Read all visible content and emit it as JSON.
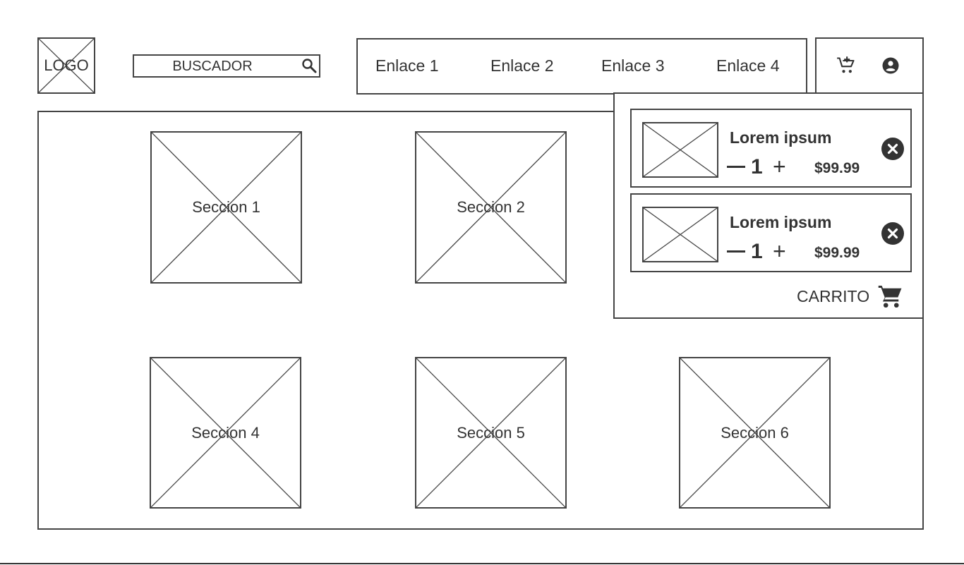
{
  "header": {
    "logo_text": "LOGO",
    "search": {
      "value": "BUSCADOR"
    },
    "nav_links": [
      "Enlace 1",
      "Enlace 2",
      "Enlace 3",
      "Enlace 4"
    ]
  },
  "sections": [
    "Seccion 1",
    "Seccion 2",
    "Seccion 4",
    "Seccion 5",
    "Seccion 6"
  ],
  "cart": {
    "items": [
      {
        "name": "Lorem ipsum",
        "quantity": "1",
        "price": "$99.99"
      },
      {
        "name": "Lorem ipsum",
        "quantity": "1",
        "price": "$99.99"
      }
    ],
    "label": "CARRITO"
  },
  "icons": [
    "add-to-cart-icon",
    "user-account-icon",
    "search-icon",
    "remove-icon",
    "cart-icon"
  ]
}
